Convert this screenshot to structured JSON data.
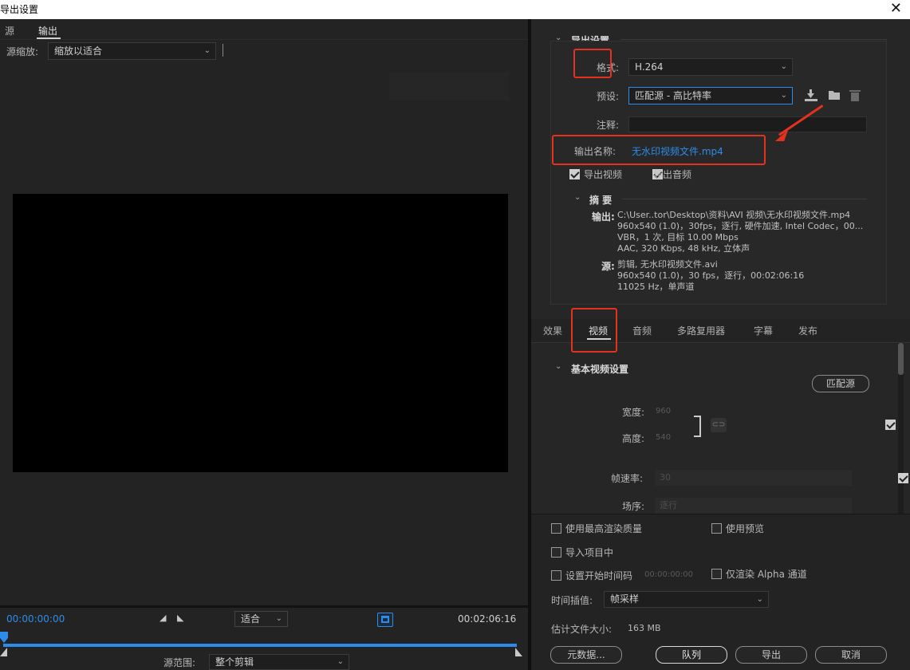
{
  "window": {
    "title": "导出设置",
    "close": "✕"
  },
  "left": {
    "tabs": [
      "源",
      "输出"
    ],
    "zoom_label": "源缩放:",
    "zoom_value": "缩放以适合",
    "time_start": "00:00:00:00",
    "fit_value": "适合",
    "time_end": "00:02:06:16",
    "range_label": "源范围:",
    "range_value": "整个剪辑"
  },
  "export": {
    "section": "导出设置",
    "format_label": "格式:",
    "format_value": "H.264",
    "preset_label": "预设:",
    "preset_value": "匹配源 - 高比特率",
    "comment_label": "注释:",
    "comment_value": "",
    "outname_label": "输出名称:",
    "outname_value": "无水印视频文件.mp4",
    "export_video": "导出视频",
    "export_audio": "导出音频"
  },
  "summary": {
    "title": "摘 要",
    "output_label": "输出:",
    "output_lines": [
      "C:\\User..tor\\Desktop\\资料\\AVI 视频\\无水印视频文件.mp4",
      "960x540 (1.0)，30fps，逐行, 硬件加速, Intel Codec，00...",
      "VBR，1 次, 目标 10.00 Mbps",
      "AAC, 320 Kbps, 48  kHz, 立体声"
    ],
    "source_label": "源:",
    "source_lines": [
      "剪辑, 无水印视频文件.avi",
      "960x540 (1.0)，30 fps，逐行，00:02:06:16",
      "11025 Hz，单声道"
    ]
  },
  "tabs": [
    "效果",
    "视频",
    "音频",
    "多路复用器",
    "字幕",
    "发布"
  ],
  "video": {
    "section": "基本视频设置",
    "match_button": "匹配源",
    "width_label": "宽度:",
    "width_value": "960",
    "height_label": "高度:",
    "height_value": "540",
    "fps_label": "帧速率:",
    "fps_value": "30",
    "field_label": "场序:",
    "field_value": "逐行"
  },
  "options": {
    "max_quality": "使用最高渲染质量",
    "use_preview": "使用预览",
    "import_project": "导入项目中",
    "set_timecode": "设置开始时间码",
    "timecode_value": "00:00:00:00",
    "alpha_only": "仅渲染 Alpha 通道",
    "interp_label": "时间插值:",
    "interp_value": "帧采样",
    "filesize_label": "估计文件大小:",
    "filesize_value": "163 MB"
  },
  "buttons": {
    "metadata": "元数据...",
    "queue": "队列",
    "export": "导出",
    "cancel": "取消"
  },
  "colors": {
    "accent_blue": "#2d8ceb",
    "highlight_red": "#e5321e"
  }
}
